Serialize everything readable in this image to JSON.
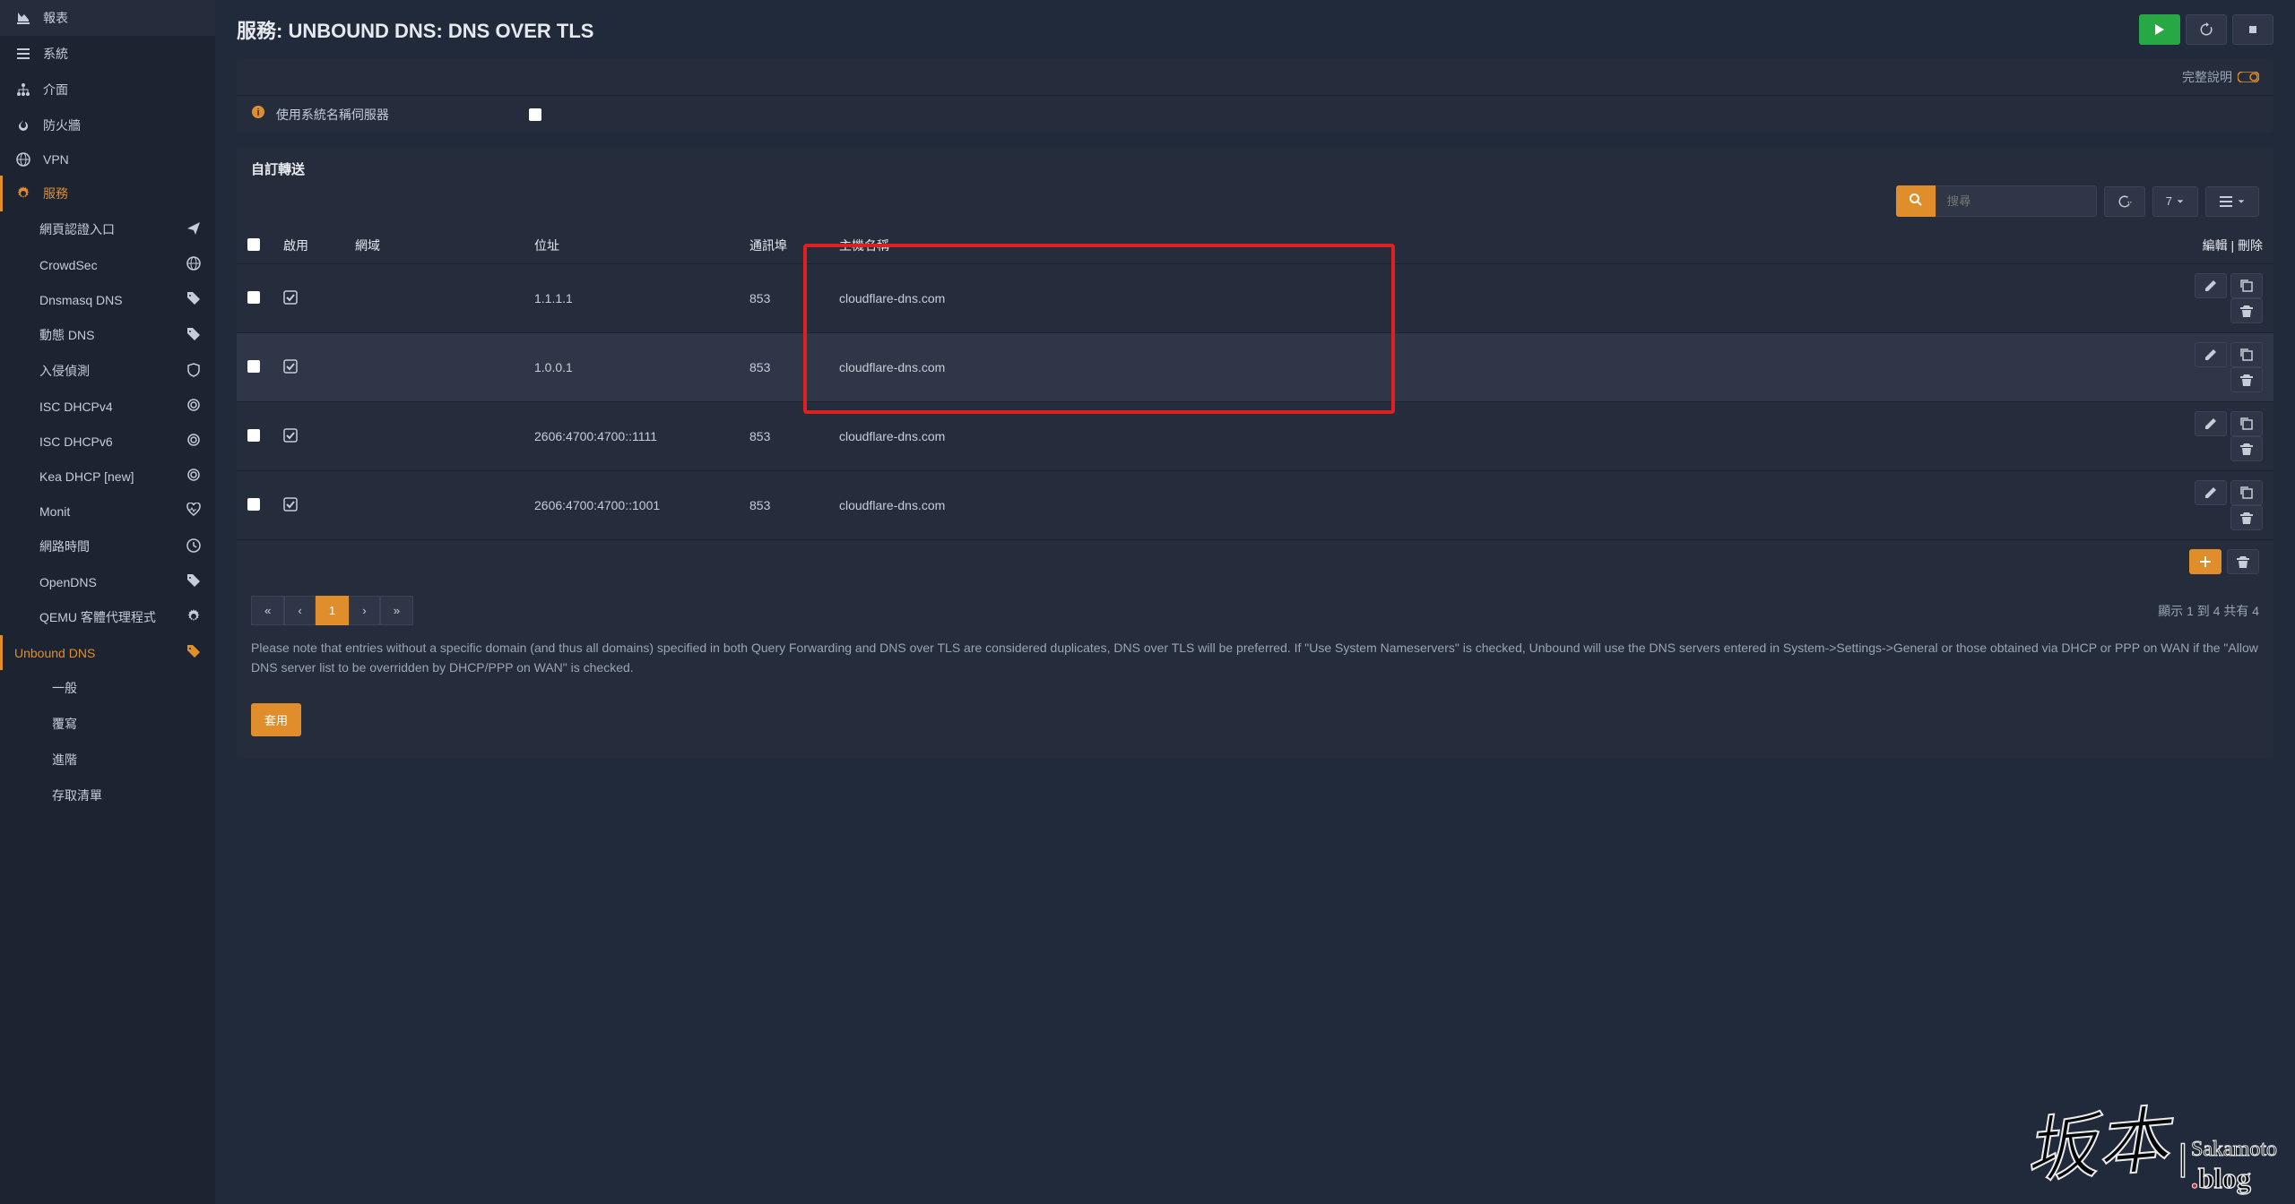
{
  "sidebar": {
    "items": [
      {
        "icon": "chart",
        "label": "報表"
      },
      {
        "icon": "layers",
        "label": "系統"
      },
      {
        "icon": "sitemap",
        "label": "介面"
      },
      {
        "icon": "fire",
        "label": "防火牆"
      },
      {
        "icon": "globe",
        "label": "VPN"
      },
      {
        "icon": "gear",
        "label": "服務",
        "active": true
      }
    ],
    "subitems": [
      {
        "label": "網頁認證入口",
        "icon": "send"
      },
      {
        "label": "CrowdSec",
        "icon": "globe"
      },
      {
        "label": "Dnsmasq DNS",
        "icon": "tag"
      },
      {
        "label": "動態 DNS",
        "icon": "tag"
      },
      {
        "label": "入侵偵測",
        "icon": "shield"
      },
      {
        "label": "ISC DHCPv4",
        "icon": "target"
      },
      {
        "label": "ISC DHCPv6",
        "icon": "target"
      },
      {
        "label": "Kea DHCP [new]",
        "icon": "target"
      },
      {
        "label": "Monit",
        "icon": "heart"
      },
      {
        "label": "網路時間",
        "icon": "clock"
      },
      {
        "label": "OpenDNS",
        "icon": "tag"
      },
      {
        "label": "QEMU 客體代理程式",
        "icon": "gear"
      },
      {
        "label": "Unbound DNS",
        "icon": "tag",
        "active": true
      }
    ],
    "subsubitems": [
      "一般",
      "覆寫",
      "進階",
      "存取清單"
    ]
  },
  "header": {
    "title": "服務: UNBOUND DNS: DNS OVER TLS"
  },
  "panel": {
    "help_label": "完整說明",
    "use_system_ns": "使用系統名稱伺服器"
  },
  "section": {
    "title": "自訂轉送",
    "search_placeholder": "搜尋",
    "page_size": "7"
  },
  "table": {
    "headers": {
      "enabled": "啟用",
      "domain": "網域",
      "address": "位址",
      "port": "通訊埠",
      "hostname": "主機名稱",
      "actions": "編輯 | 刪除"
    },
    "rows": [
      {
        "enabled": true,
        "domain": "",
        "address": "1.1.1.1",
        "port": "853",
        "hostname": "cloudflare-dns.com"
      },
      {
        "enabled": true,
        "domain": "",
        "address": "1.0.0.1",
        "port": "853",
        "hostname": "cloudflare-dns.com",
        "hover": true
      },
      {
        "enabled": true,
        "domain": "",
        "address": "2606:4700:4700::1111",
        "port": "853",
        "hostname": "cloudflare-dns.com"
      },
      {
        "enabled": true,
        "domain": "",
        "address": "2606:4700:4700::1001",
        "port": "853",
        "hostname": "cloudflare-dns.com"
      }
    ]
  },
  "pagination": {
    "current": "1",
    "info": "顯示 1 到 4 共有 4"
  },
  "note": "Please note that entries without a specific domain (and thus all domains) specified in both Query Forwarding and DNS over TLS are considered duplicates, DNS over TLS will be preferred. If \"Use System Nameservers\" is checked, Unbound will use the DNS servers entered in System->Settings->General or those obtained via DHCP or PPP on WAN if the \"Allow DNS server list to be overridden by DHCP/PPP on WAN\" is checked.",
  "apply": "套用",
  "watermark": {
    "kanji": "坂本",
    "top": "Sakamoto",
    "bot": "blog"
  }
}
